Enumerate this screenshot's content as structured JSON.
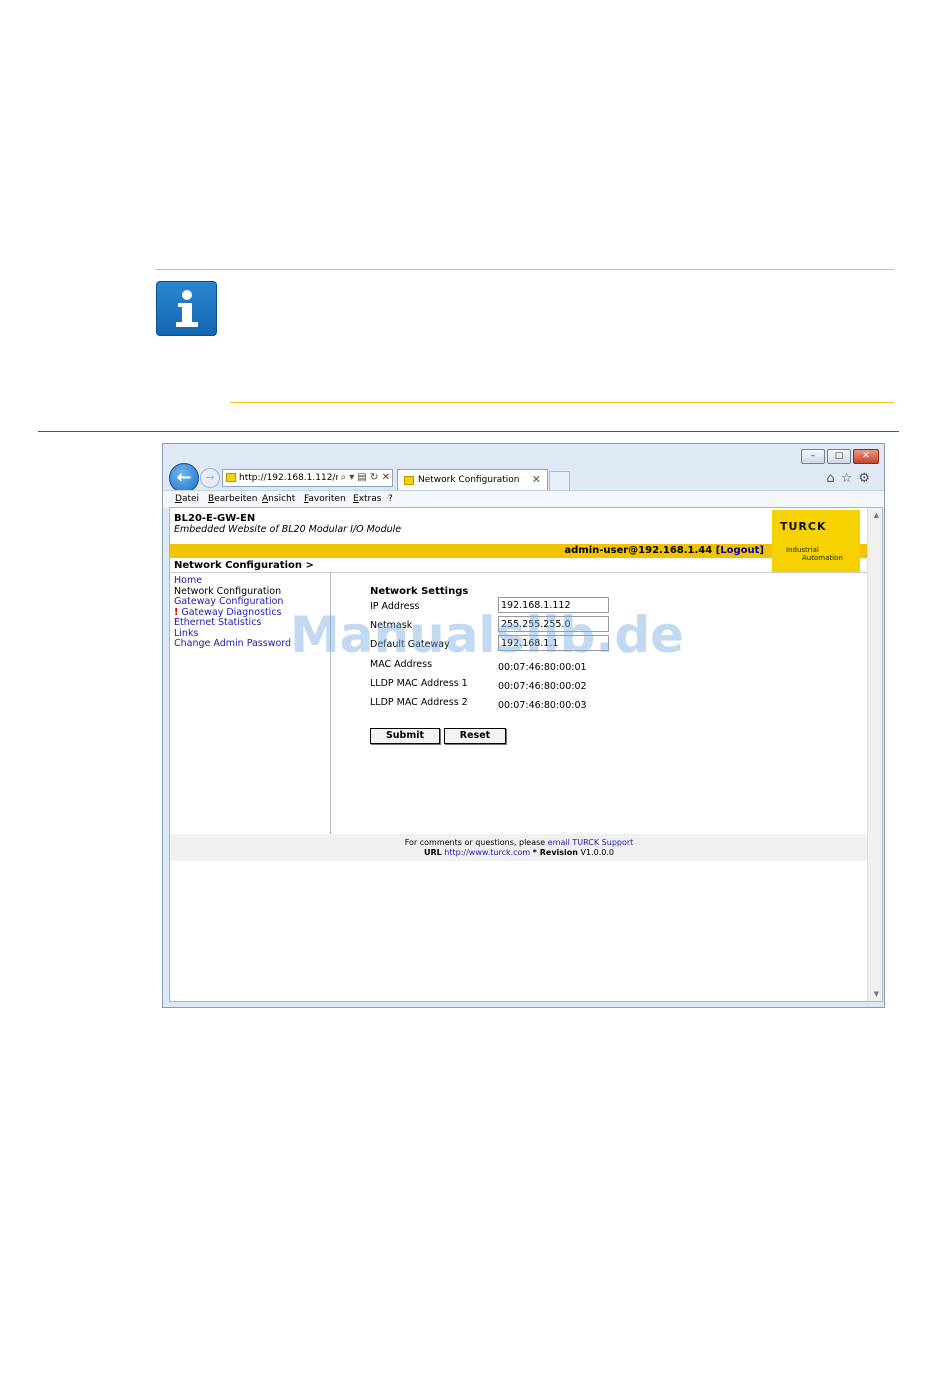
{
  "browser": {
    "address": "http://192.168.1.112/n",
    "tab_title": "Network Configuration",
    "menu": [
      "Datei",
      "Bearbeiten",
      "Ansicht",
      "Favoriten",
      "Extras",
      "?"
    ]
  },
  "site": {
    "device_name": "BL20-E-GW-EN",
    "subtitle": "Embedded Website of BL20 Modular I/O Module",
    "user": "admin-user@192.168.1.44",
    "logout_label": "[Logout]",
    "logo": {
      "name": "TURCK",
      "line1": "Industrial",
      "line2": "Automation"
    },
    "breadcrumb": "Network Configuration >"
  },
  "nav": {
    "items": [
      {
        "label": "Home",
        "state": "link"
      },
      {
        "label": "Network Configuration",
        "state": "current"
      },
      {
        "label": "Gateway Configuration",
        "state": "link"
      },
      {
        "label": "Gateway Diagnostics",
        "state": "link",
        "prefix": "!"
      },
      {
        "label": "Ethernet Statistics",
        "state": "link"
      },
      {
        "label": "Links",
        "state": "link"
      },
      {
        "label": "Change Admin Password",
        "state": "link"
      }
    ]
  },
  "form": {
    "title": "Network Settings",
    "ip_label": "IP Address",
    "ip_value": "192.168.1.112",
    "netmask_label": "Netmask",
    "netmask_value": "255.255.255.0",
    "gateway_label": "Default Gateway",
    "gateway_value": "192.168.1.1",
    "mac_label": "MAC Address",
    "mac_value": "00:07:46:80:00:01",
    "lldp1_label": "LLDP MAC Address 1",
    "lldp1_value": "00:07:46:80:00:02",
    "lldp2_label": "LLDP MAC Address 2",
    "lldp2_value": "00:07:46:80:00:03",
    "submit_label": "Submit",
    "reset_label": "Reset"
  },
  "footer": {
    "line1_text": "For comments or questions, please",
    "line1_link": "email TURCK Support",
    "url_label": "URL",
    "url_value": "http://www.turck.com",
    "revision_label": "* Revision",
    "revision_value": "V1.0.0.0"
  },
  "watermark": "Manualslib.de",
  "colors": {
    "accent_yellow": "#f2c400",
    "link_blue": "#1a1ab0",
    "info_blue": "#1567b0"
  }
}
